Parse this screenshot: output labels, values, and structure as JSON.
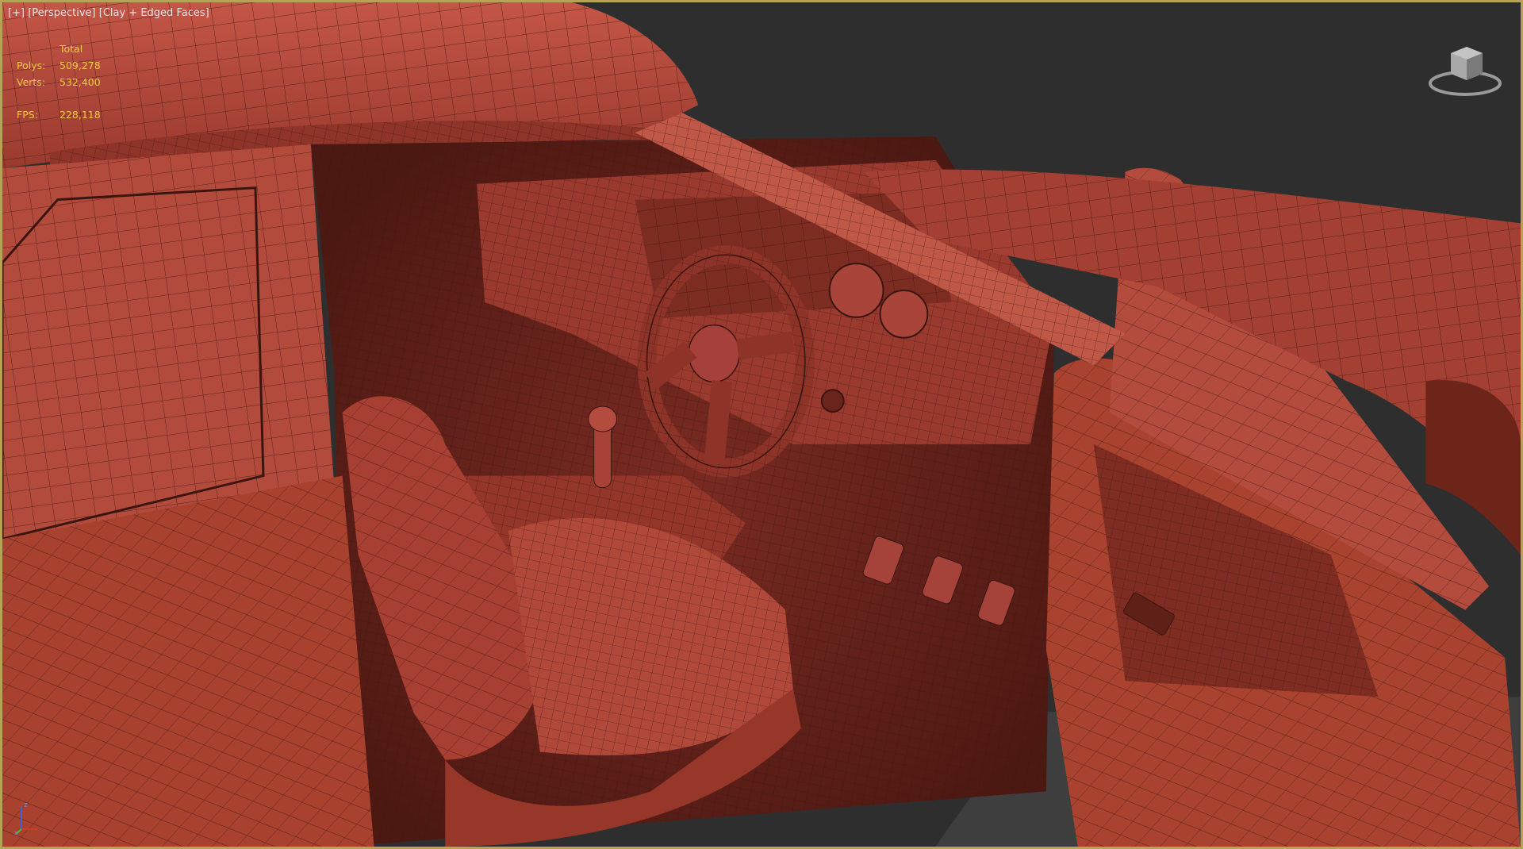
{
  "viewport": {
    "labels": {
      "plus": "[+]",
      "view": "[Perspective]",
      "shading": "[Clay + Edged Faces]"
    },
    "stats": {
      "header": "Total",
      "polys_label": "Polys:",
      "polys_value": "509,278",
      "verts_label": "Verts:",
      "verts_value": "532,400",
      "fps_label": "FPS:",
      "fps_value": "228,118"
    },
    "axis": {
      "z": "z",
      "x": "x"
    }
  },
  "colors": {
    "clay": "#b84a3c",
    "clay_dark": "#7e2e24",
    "clay_light": "#cf6250",
    "wire": "#3a1510",
    "background": "#2e2e2e",
    "active_border": "#b7a255",
    "stats_text": "#f3c94a"
  }
}
